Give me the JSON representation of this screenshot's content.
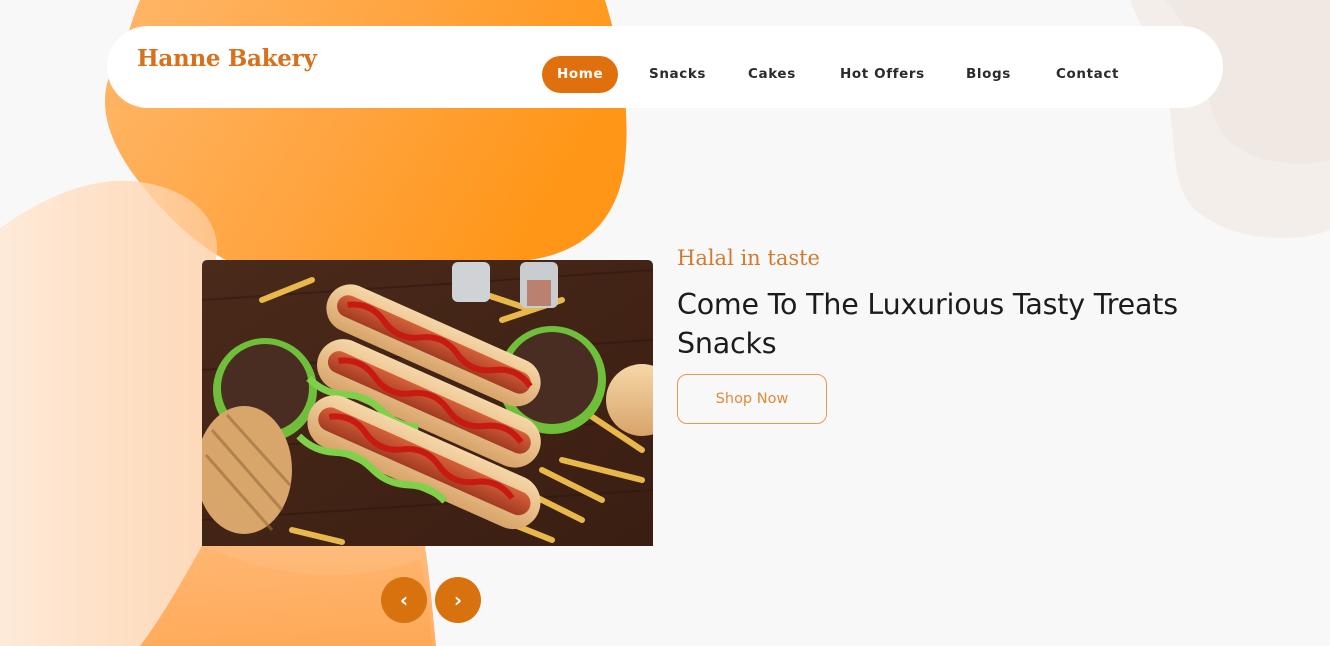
{
  "brand": {
    "name": "Hanne Bakery"
  },
  "nav": {
    "items": [
      {
        "label": "Home",
        "active": true
      },
      {
        "label": "Snacks",
        "active": false
      },
      {
        "label": "Cakes",
        "active": false
      },
      {
        "label": "Hot Offers",
        "active": false
      },
      {
        "label": "Blogs",
        "active": false
      },
      {
        "label": "Contact",
        "active": false
      }
    ]
  },
  "hero": {
    "tagline": "Halal in taste",
    "headline": "Come To The Luxurious Tasty Treats Snacks",
    "cta_label": "Shop Now",
    "prev_label": "‹",
    "next_label": "›"
  },
  "colors": {
    "accent": "#e0700e",
    "brand_text": "#d9711b",
    "blob_orange": "#ff9a2a",
    "background": "#f8f8f8"
  }
}
